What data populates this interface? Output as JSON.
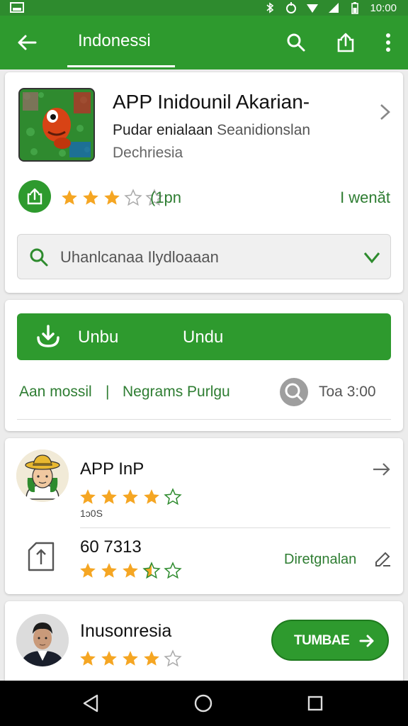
{
  "status_bar": {
    "time": "10:00"
  },
  "app_bar": {
    "title": "Indonessi"
  },
  "app_card": {
    "title": "APP Inidounil Akarian-",
    "subtitle_part1": "Pudar enialaan",
    "subtitle_part2": "Seanidionslan",
    "category": "Dechriesia",
    "rating_stars": 3,
    "rating_text": "(1pn",
    "rating_right": "I wenăt",
    "search_text": "Uhanlcanaa Ilydloaaan"
  },
  "download_card": {
    "button_label_1": "Unbu",
    "button_label_2": "Undu",
    "link_1": "Aan mossil",
    "separator": "|",
    "link_2": "Negrams Purlgu",
    "time_text": "Toa 3:00"
  },
  "review_card": {
    "reviewer_name": "APP InP",
    "reviewer_stars": 4,
    "reviewer_date": "1ↄ0S",
    "review2_number": "60  7313",
    "review2_stars": 3.5,
    "review2_action": "Diretgnalan"
  },
  "bottom_card": {
    "name": "Inusonresia",
    "stars": 4,
    "button_label": "TUMBAE"
  },
  "colors": {
    "primary_green": "#2e9a2e",
    "star_yellow": "#f5a623",
    "link_green": "#2e7d32"
  }
}
